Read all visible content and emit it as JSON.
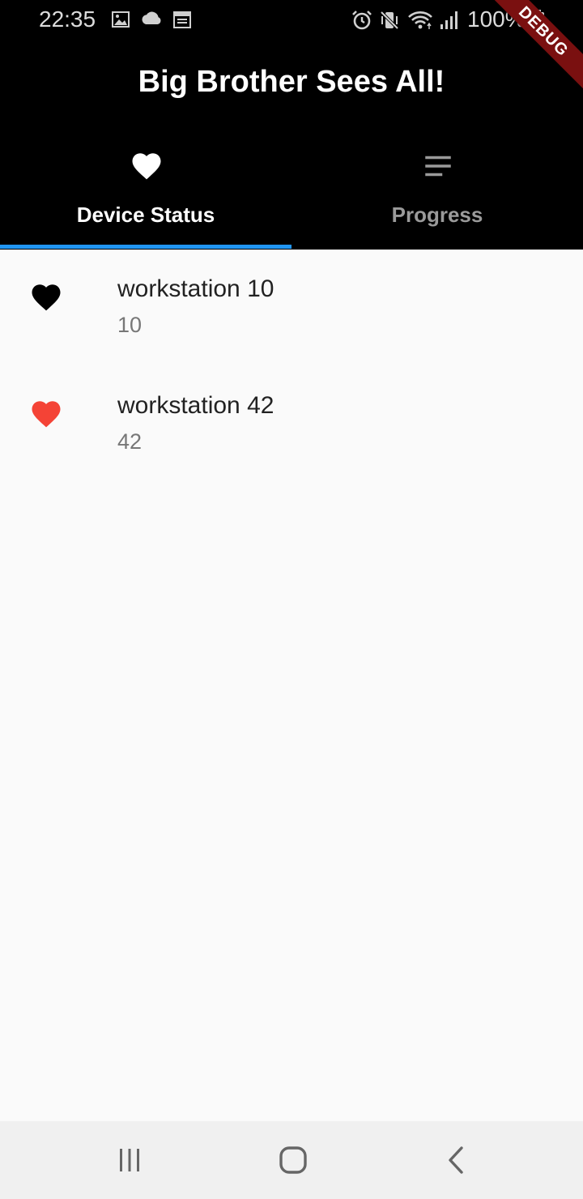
{
  "status_bar": {
    "time": "22:35",
    "battery": "100%",
    "left_icons": [
      "image-icon",
      "cloud-icon",
      "calendar-icon"
    ],
    "right_icons": [
      "alarm-icon",
      "vibrate-icon",
      "wifi-icon",
      "signal-icon",
      "battery-icon"
    ]
  },
  "app": {
    "title": "Big Brother Sees All!",
    "debug_banner": "DEBUG"
  },
  "tabs": [
    {
      "label": "Device Status",
      "icon": "heart-icon",
      "selected": true
    },
    {
      "label": "Progress",
      "icon": "menu-lines-icon",
      "selected": false
    }
  ],
  "devices": [
    {
      "name": "workstation 10",
      "id": "10",
      "icon": "heart-icon",
      "color": "#000000"
    },
    {
      "name": "workstation 42",
      "id": "42",
      "icon": "heart-icon",
      "color": "#f44336"
    }
  ],
  "colors": {
    "app_bar": "#000000",
    "tab_indicator": "#2196f3",
    "background": "#fafafa"
  },
  "nav_bar": {
    "buttons": [
      "recents-icon",
      "home-icon",
      "back-icon"
    ]
  }
}
